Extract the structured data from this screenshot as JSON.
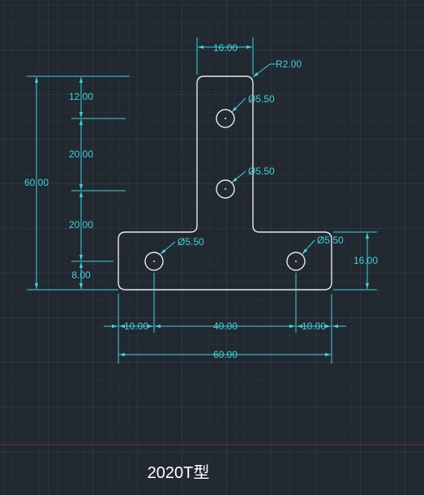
{
  "drawing": {
    "caption": "2020T型",
    "colors": {
      "background": "#212830",
      "grid_minor": "#2b333c",
      "grid_major": "#36404b",
      "outline": "#e8e8e8",
      "dimension": "#3fd3dc",
      "axis_red": "#7a2a30"
    },
    "dimensions": {
      "top_width": "16.00",
      "corner_radius": "R2.00",
      "hole_top_1": "Ø5.50",
      "hole_top_2": "Ø5.50",
      "hole_bottom_left": "Ø5.50",
      "hole_bottom_right": "Ø5.50",
      "overall_height": "60.00",
      "seg_12": "12.00",
      "seg_20a": "20.00",
      "seg_20b": "20.00",
      "seg_8": "8.00",
      "base_height": "16.00",
      "left_offset": "10.00",
      "hole_span": "40.00",
      "right_offset": "10.00",
      "overall_width": "60.00"
    }
  }
}
